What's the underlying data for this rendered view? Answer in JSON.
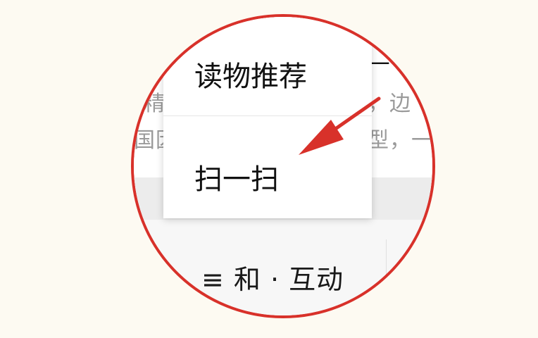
{
  "background_text": {
    "header_fragment": "—",
    "row1_left": "精",
    "row1_right": "，边",
    "row2_left": "国因",
    "row2_right": "型，一"
  },
  "menu": {
    "items": [
      {
        "label": "读物推荐"
      },
      {
        "label": "扫一扫"
      }
    ]
  },
  "bottom_bar": {
    "label": "≡ 和 · 互动"
  },
  "colors": {
    "accent": "#d8312a",
    "page_bg": "#fdfaf2"
  }
}
